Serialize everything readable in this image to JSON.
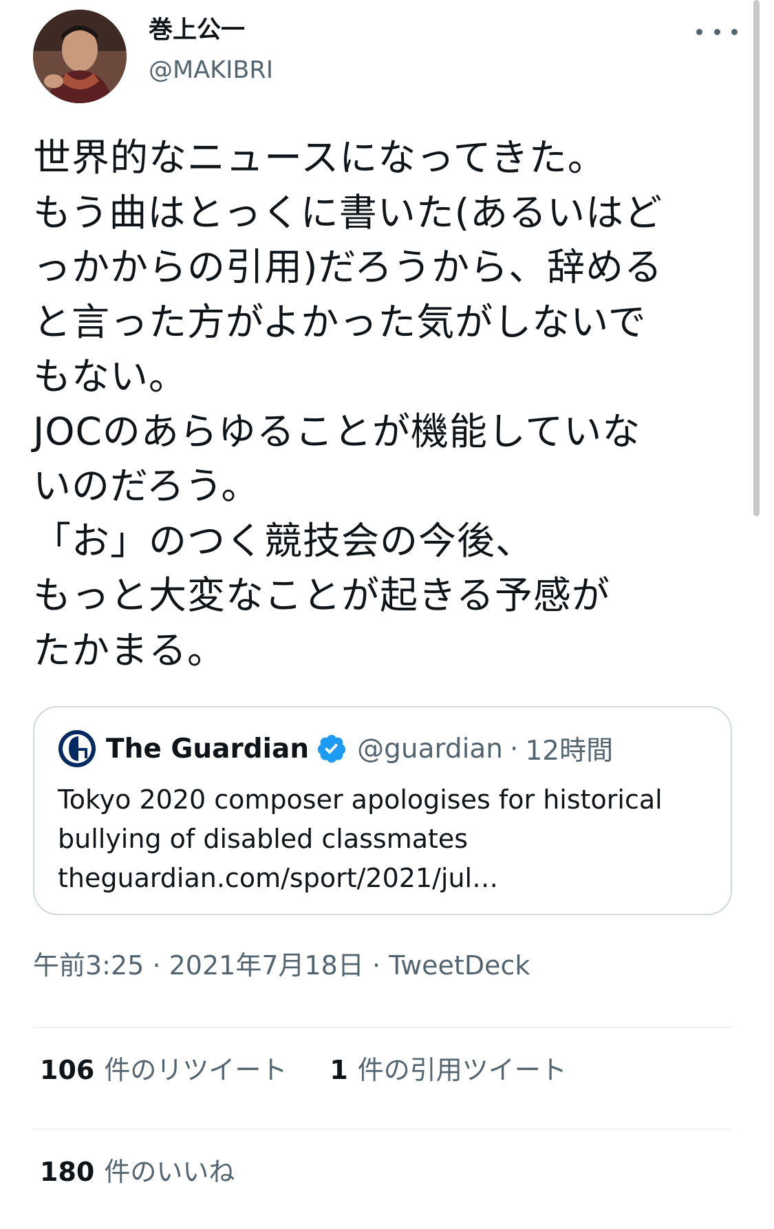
{
  "author": {
    "display_name": "巻上公一",
    "handle": "@MAKIBRI",
    "avatar_icon": "user-avatar-photo"
  },
  "more_icon": "ellipsis-icon",
  "tweet": {
    "lines": [
      "世界的なニュースになってきた。",
      "もう曲はとっくに書いた(あるいはど",
      "っかからの引用)だろうから、辞める",
      "と言った方がよかった気がしないで",
      "もない。",
      "JOCのあらゆることが機能していな",
      "いのだろう。",
      "「お」のつく競技会の今後、",
      "もっと大変なことが起きる予感が",
      "たかまる。"
    ]
  },
  "quoted_tweet": {
    "name": "The Guardian",
    "handle": "@guardian",
    "separator": "·",
    "time": "12時間",
    "verified_icon": "verified-badge-icon",
    "logo_icon": "guardian-logo-icon",
    "text_lines": [
      "Tokyo 2020 composer apologises for historical",
      "bullying of disabled classmates",
      "theguardian.com/sport/2021/jul…"
    ]
  },
  "meta": {
    "time": "午前3:25",
    "sep1": "·",
    "date": "2021年7月18日",
    "sep2": "·",
    "client": "TweetDeck"
  },
  "stats": {
    "retweets_count": "106",
    "retweets_label": "件のリツイート",
    "quotes_count": "1",
    "quotes_label": "件の引用ツイート",
    "likes_count": "180",
    "likes_label": "件のいいね"
  },
  "colors": {
    "text_primary": "#0f1419",
    "text_secondary": "#536471",
    "border": "#cfd9de",
    "verified": "#1d9bf0"
  }
}
